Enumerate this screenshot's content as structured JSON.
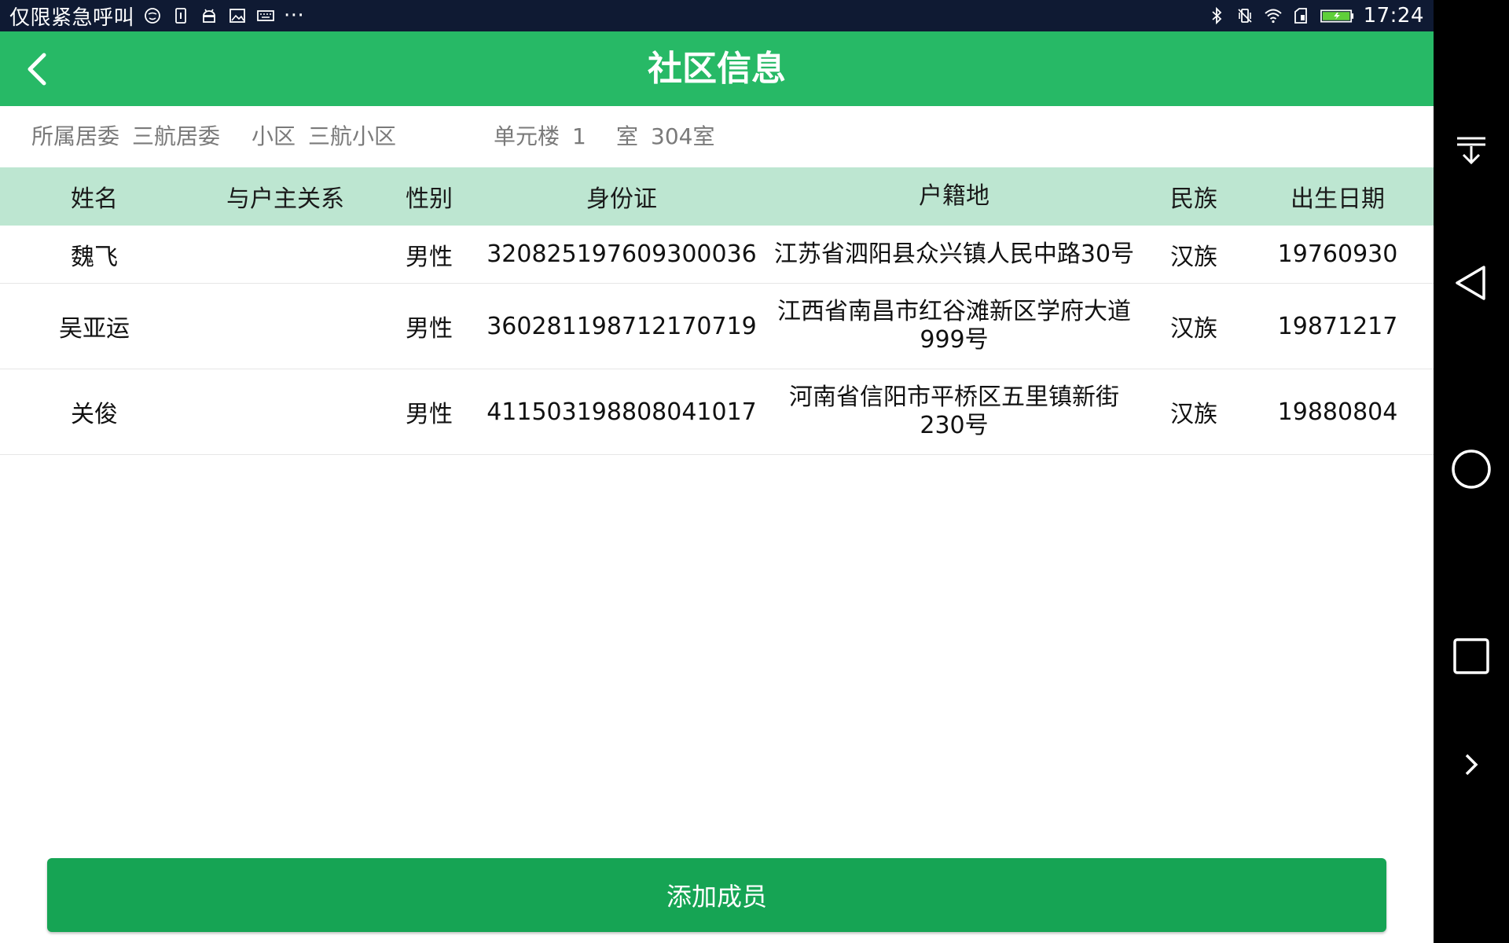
{
  "status_bar": {
    "carrier_text": "仅限紧急呼叫",
    "more": "···",
    "time": "17:24",
    "left_icons": [
      "face-icon",
      "sim-icon",
      "android-icon",
      "image-icon",
      "keyboard-icon"
    ],
    "right_icons": [
      "bluetooth-icon",
      "vibrate-icon",
      "wifi-icon",
      "data-icon",
      "battery-icon"
    ]
  },
  "header": {
    "title": "社区信息",
    "background": "#27b966"
  },
  "info": {
    "committee_label": "所属居委",
    "committee_value": "三航居委",
    "community_label": "小区",
    "community_value": "三航小区",
    "building_label": "单元楼",
    "building_value": "1",
    "room_label": "室",
    "room_value": "304室"
  },
  "table": {
    "columns": [
      "姓名",
      "与户主关系",
      "性别",
      "身份证",
      "户籍地",
      "民族",
      "出生日期"
    ],
    "rows": [
      {
        "name": "魏飞",
        "relation": "",
        "gender": "男性",
        "id_number": "320825197609300036",
        "residence": "江苏省泗阳县众兴镇人民中路30号",
        "ethnicity": "汉族",
        "birth_date": "19760930"
      },
      {
        "name": "吴亚运",
        "relation": "",
        "gender": "男性",
        "id_number": "360281198712170719",
        "residence": "江西省南昌市红谷滩新区学府大道999号",
        "ethnicity": "汉族",
        "birth_date": "19871217"
      },
      {
        "name": "关俊",
        "relation": "",
        "gender": "男性",
        "id_number": "411503198808041017",
        "residence": "河南省信阳市平桥区五里镇新街230号",
        "ethnicity": "汉族",
        "birth_date": "19880804"
      }
    ],
    "header_background": "#bde6d1"
  },
  "actions": {
    "add_member_label": "添加成员",
    "button_color": "#16a454"
  },
  "nav_bar": {
    "icons": [
      "notification-pull-icon",
      "back-triangle-icon",
      "home-circle-icon",
      "recents-square-icon",
      "chevron-right-icon"
    ]
  }
}
